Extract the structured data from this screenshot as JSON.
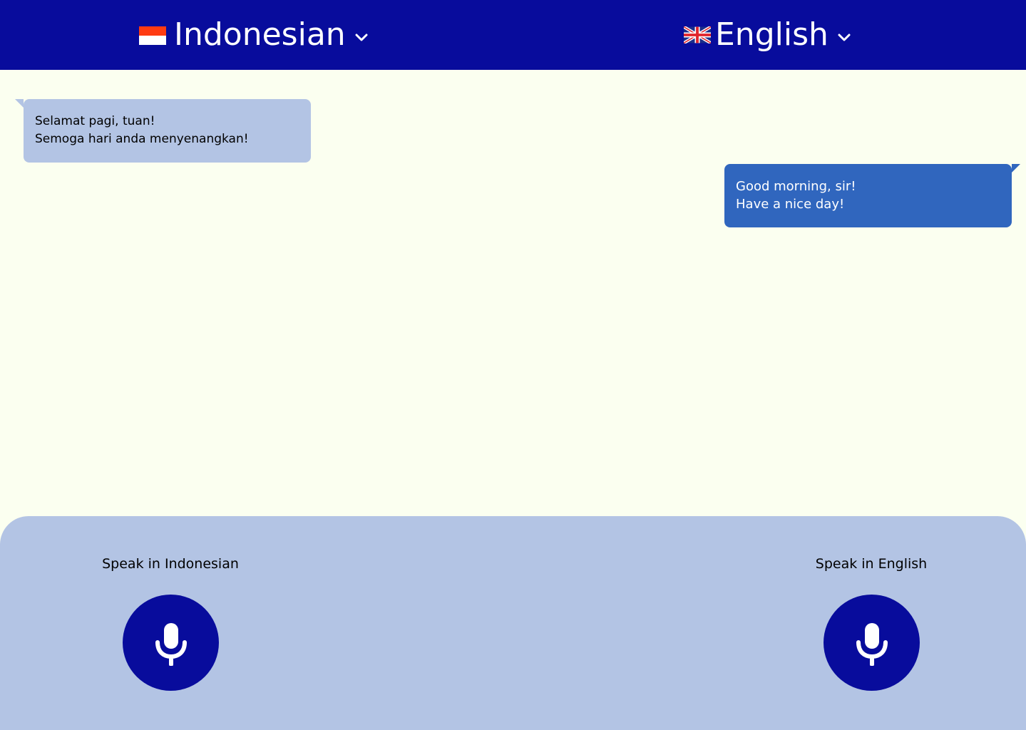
{
  "header": {
    "source_language": {
      "label": "Indonesian",
      "flag_icon": "indonesia-flag-icon",
      "dropdown_icon": "chevron-down-icon"
    },
    "target_language": {
      "label": "English",
      "flag_icon": "uk-flag-icon",
      "dropdown_icon": "chevron-down-icon"
    }
  },
  "conversation": {
    "messages": [
      {
        "side": "source",
        "lines": [
          "Selamat pagi, tuan!",
          "Semoga hari anda menyenangkan!"
        ]
      },
      {
        "side": "target",
        "lines": [
          "Good morning, sir!",
          "Have a nice day!"
        ]
      }
    ]
  },
  "speak_panel": {
    "left": {
      "label": "Speak in Indonesian",
      "icon": "microphone-icon"
    },
    "right": {
      "label": "Speak in English",
      "icon": "microphone-icon"
    }
  },
  "colors": {
    "header_bg": "#080c9c",
    "page_bg": "#fbfff0",
    "panel_bg": "#b3c4e4",
    "source_bubble": "#b3c4e4",
    "target_bubble": "#3066be",
    "mic_button": "#080c9c"
  }
}
